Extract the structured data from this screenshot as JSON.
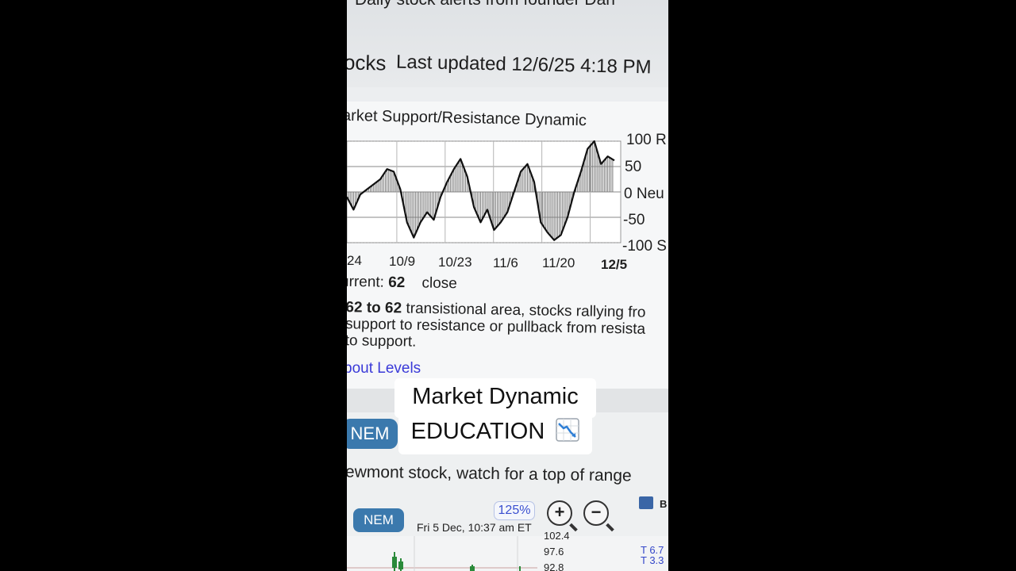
{
  "header": {
    "alerts_text": "Daily stock alerts from founder Dan",
    "section_title": "ocks",
    "last_updated": "Last updated 12/6/25 4:18 PM"
  },
  "chart": {
    "title": "arket Support/Resistance Dynamic",
    "y_labels": [
      "100 R",
      "50",
      "0 Neu",
      "-50",
      "-100 S"
    ],
    "x_labels": [
      "24",
      "10/9",
      "10/23",
      "11/6",
      "11/20",
      "12/5"
    ],
    "current_label": "urrent:",
    "current_value": "62",
    "close_label": "close",
    "desc_bold": "62 to 62",
    "desc_rest": " transistional area, stocks rallying fro",
    "desc_line2": "support to resistance or pullback from resista",
    "desc_line3": "to support.",
    "levels_link": "bout Levels"
  },
  "chart_data": {
    "type": "line",
    "title": "arket Support/Resistance Dynamic",
    "ylim": [
      -100,
      100
    ],
    "x": [
      "24",
      "10/9",
      "10/23",
      "11/6",
      "11/20",
      "12/5"
    ],
    "series": [
      {
        "values": [
          -10,
          -35,
          -5,
          5,
          15,
          25,
          45,
          40,
          5,
          -60,
          -90,
          -60,
          -40,
          -55,
          -10,
          20,
          45,
          65,
          30,
          -30,
          -60,
          -35,
          -75,
          -60,
          -40,
          0,
          40,
          55,
          20,
          -60,
          -80,
          -95,
          -85,
          -50,
          0,
          40,
          85,
          100,
          55,
          70,
          62
        ]
      }
    ],
    "current": 62,
    "grid": true
  },
  "caption": {
    "line1": "Market Dynamic",
    "line2": "EDUCATION"
  },
  "stock": {
    "symbol": "NEM",
    "headline": "ewmont stock, watch for a top of range",
    "toolbar_symbol": "NEM",
    "zoom": "125%",
    "zoom_in": "+",
    "zoom_out": "−",
    "bookmark_label": "B",
    "datetime": "Fri 5 Dec, 10:37 am ET",
    "prices": [
      "102.4",
      "97.6",
      "92.8"
    ],
    "t_labels": [
      "T 6.7",
      "T 3.3"
    ]
  },
  "colors": {
    "nem_pill": "#3b79ad",
    "link": "#3a3ad8",
    "zoom_text": "#3a4fd0"
  }
}
